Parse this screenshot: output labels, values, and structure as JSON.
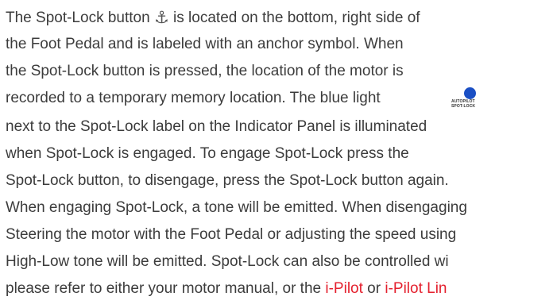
{
  "paragraph": {
    "line1": {
      "before": "The Spot-Lock button ",
      "icon": "⚓",
      "after": " is located on the bottom, right side of"
    },
    "line2": "the Foot Pedal and is labeled with an anchor symbol. When",
    "line3": "the Spot-Lock button is pressed, the location of the motor is",
    "line4": "recorded to a temporary memory location. The blue light",
    "line5": "next to the Spot-Lock label on the Indicator Panel is illuminated",
    "line6": "when Spot-Lock is engaged. To engage Spot-Lock press the",
    "line7": "Spot-Lock button, to disengage, press the Spot-Lock button again.",
    "line8": "When engaging Spot-Lock, a tone will be emitted. When disengaging",
    "line9": "Steering the motor with the Foot Pedal or adjusting the speed using",
    "line10": "High-Low tone will be emitted. Spot-Lock can also be controlled wi",
    "line11": {
      "before": "please refer to either your motor manual, or the ",
      "link1": "i-Pilot",
      "middle": " or ",
      "link2": "i-Pilot Lin"
    }
  },
  "indicator": {
    "line1": "AUTOPILOT",
    "line2": "SPOT-LOCK",
    "light_color": "#1a4fc4"
  },
  "colors": {
    "text": "#3c3c3c",
    "link": "#e4202e"
  }
}
